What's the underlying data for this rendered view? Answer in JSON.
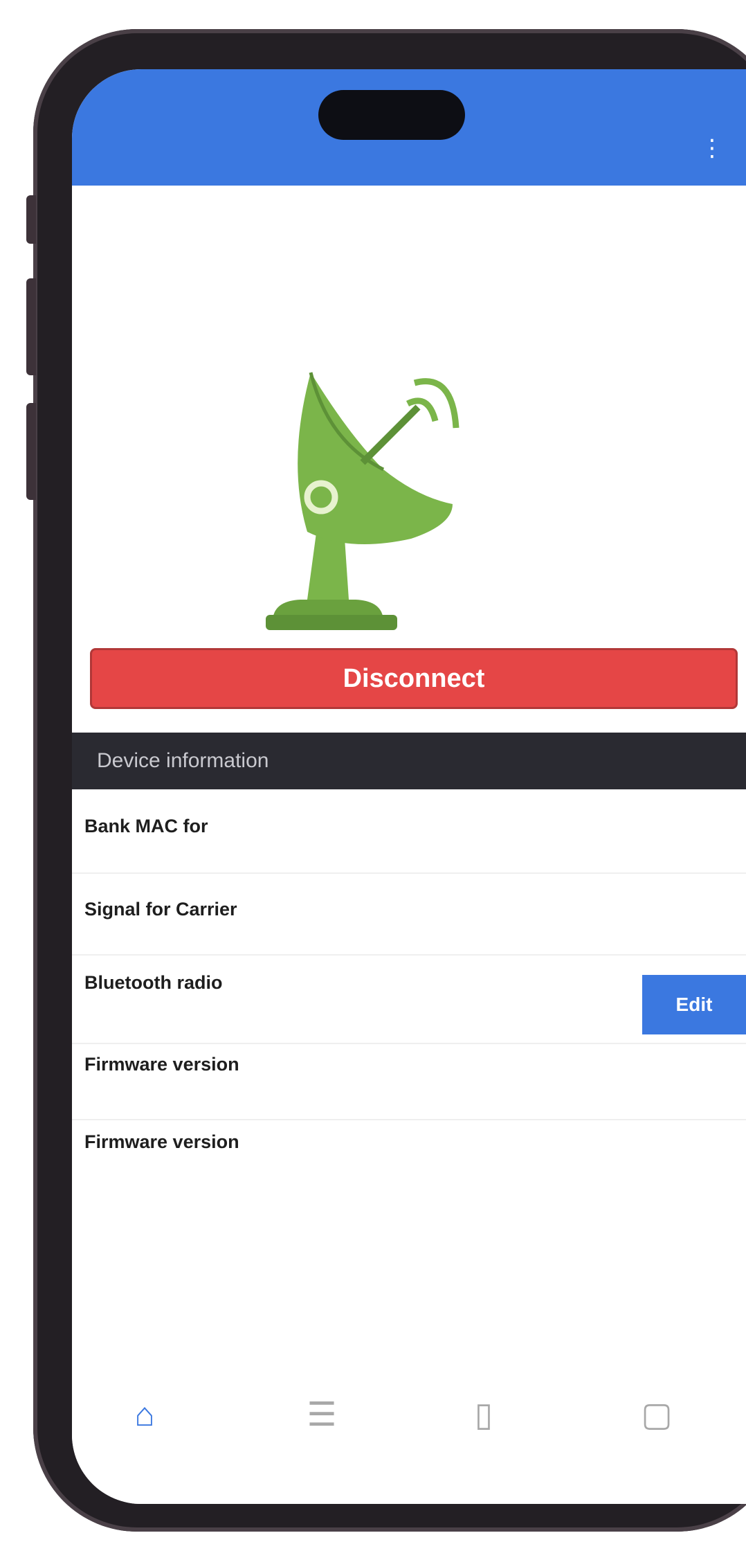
{
  "status_bar": {
    "time": "",
    "indicators": ""
  },
  "appbar": {
    "title": "",
    "menu_icon": "more-vertical-icon"
  },
  "hero": {
    "image": "satellite-dish-antenna-icon",
    "dish_color": "#7bb54a"
  },
  "disconnect_button": {
    "label": "Disconnect"
  },
  "section": {
    "title": "Device information"
  },
  "info_rows": [
    {
      "label": "Bank MAC for",
      "value": ""
    },
    {
      "label": "Signal for Carrier",
      "value": ""
    },
    {
      "label": "Bluetooth radio",
      "value": "",
      "action": "Edit"
    },
    {
      "label": "Firmware version",
      "value": ""
    },
    {
      "label": "Firmware version",
      "value": ""
    }
  ],
  "tabbar": {
    "tabs": [
      {
        "label": "",
        "icon": "home-icon",
        "active": true
      },
      {
        "label": "",
        "icon": "list-icon",
        "active": false
      },
      {
        "label": "",
        "icon": "device-icon",
        "active": false
      },
      {
        "label": "",
        "icon": "settings-icon",
        "active": false
      }
    ]
  },
  "colors": {
    "primary": "#3b78e0",
    "danger": "#e54646",
    "section_bg": "#2a2a31"
  }
}
